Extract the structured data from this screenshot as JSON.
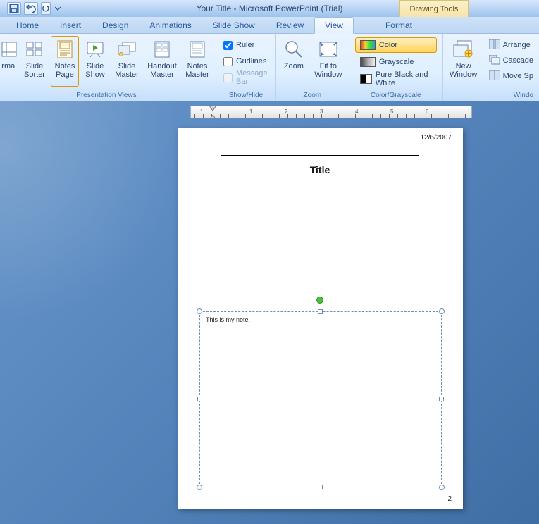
{
  "titlebar": {
    "title": "Your Title - Microsoft PowerPoint (Trial)",
    "context_tab": "Drawing Tools"
  },
  "tabs": {
    "home": "Home",
    "insert": "Insert",
    "design": "Design",
    "animations": "Animations",
    "slideshow": "Slide Show",
    "review": "Review",
    "view": "View",
    "format": "Format",
    "active": "view"
  },
  "ribbon": {
    "groups": {
      "presentation_views": {
        "label": "Presentation Views",
        "normal": "rmal",
        "slide_sorter": "Slide\nSorter",
        "notes_page": "Notes\nPage",
        "slide_show": "Slide\nShow",
        "slide_master": "Slide\nMaster",
        "handout_master": "Handout\nMaster",
        "notes_master": "Notes\nMaster"
      },
      "show_hide": {
        "label": "Show/Hide",
        "ruler": "Ruler",
        "gridlines": "Gridlines",
        "message_bar": "Message Bar"
      },
      "zoom": {
        "label": "Zoom",
        "zoom_btn": "Zoom",
        "fit": "Fit to\nWindow"
      },
      "color_grayscale": {
        "label": "Color/Grayscale",
        "color": "Color",
        "grayscale": "Grayscale",
        "bw": "Pure Black and White"
      },
      "window": {
        "label": "Windo",
        "new_window": "New\nWindow",
        "arrange": "Arrange",
        "cascade": "Cascade",
        "move_split": "Move Sp"
      }
    }
  },
  "ruler": {
    "labels": [
      "1",
      "1",
      "2",
      "3",
      "4",
      "5",
      "6"
    ],
    "positions": [
      15,
      85,
      135,
      185,
      235,
      285,
      335
    ]
  },
  "page": {
    "date": "12/6/2007",
    "slide_title": "Title",
    "notes_text": "This is my note.",
    "page_number": "2"
  }
}
